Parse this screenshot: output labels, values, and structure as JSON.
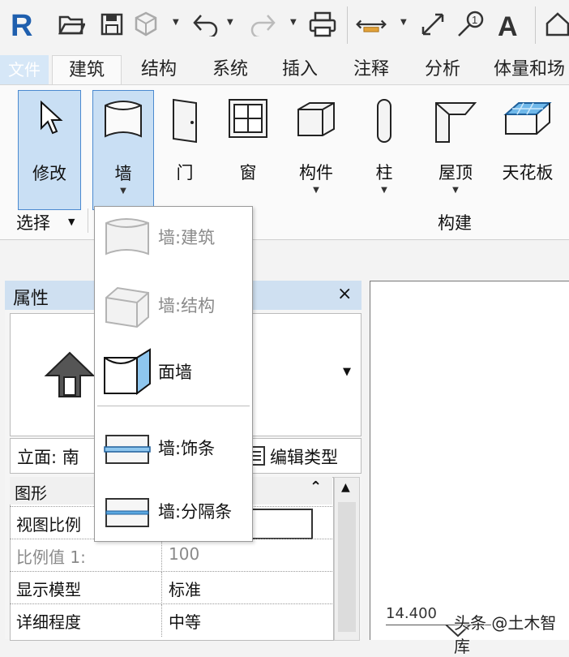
{
  "quick_access": {
    "items": [
      "revit-logo-icon",
      "open-icon",
      "save-icon",
      "sync-icon",
      "undo-icon",
      "redo-icon",
      "print-icon",
      "measure-icon",
      "dimension-icon",
      "tag-icon",
      "text-icon",
      "home-icon"
    ]
  },
  "tabs": {
    "file": "文件",
    "architecture": "建筑",
    "structure": "结构",
    "systems": "系统",
    "insert": "插入",
    "annotate": "注释",
    "analyze": "分析",
    "massing": "体量和场"
  },
  "ribbon": {
    "modify": "修改",
    "wall": "墙",
    "door": "门",
    "window": "窗",
    "component": "构件",
    "column": "柱",
    "roof": "屋顶",
    "ceiling": "天花板",
    "select_panel": "选择",
    "build_panel": "构建"
  },
  "wall_menu": {
    "items": [
      {
        "label": "墙:建筑",
        "enabled": false
      },
      {
        "label": "墙:结构",
        "enabled": false
      },
      {
        "label": "面墙",
        "enabled": true
      },
      {
        "label": "墙:饰条",
        "enabled": true
      },
      {
        "label": "墙:分隔条",
        "enabled": true
      }
    ]
  },
  "properties": {
    "title": "属性",
    "close": "×",
    "view": "立面: 南",
    "edit_type": "编辑类型",
    "group": "图形",
    "group_toggle": "⌃",
    "rows": [
      {
        "name": "视图比例",
        "value": ""
      },
      {
        "name": "比例值 1:",
        "value": "100"
      },
      {
        "name": "显示模型",
        "value": "标准"
      },
      {
        "name": "详细程度",
        "value": "中等"
      }
    ]
  },
  "canvas": {
    "level": "14.400"
  },
  "watermark": "头条 @土木智库",
  "colors": {
    "accent": "#c9dff4",
    "accent_border": "#4b8ad0",
    "panel_header": "#cfe0f1",
    "revit_blue": "#1f5fae"
  }
}
